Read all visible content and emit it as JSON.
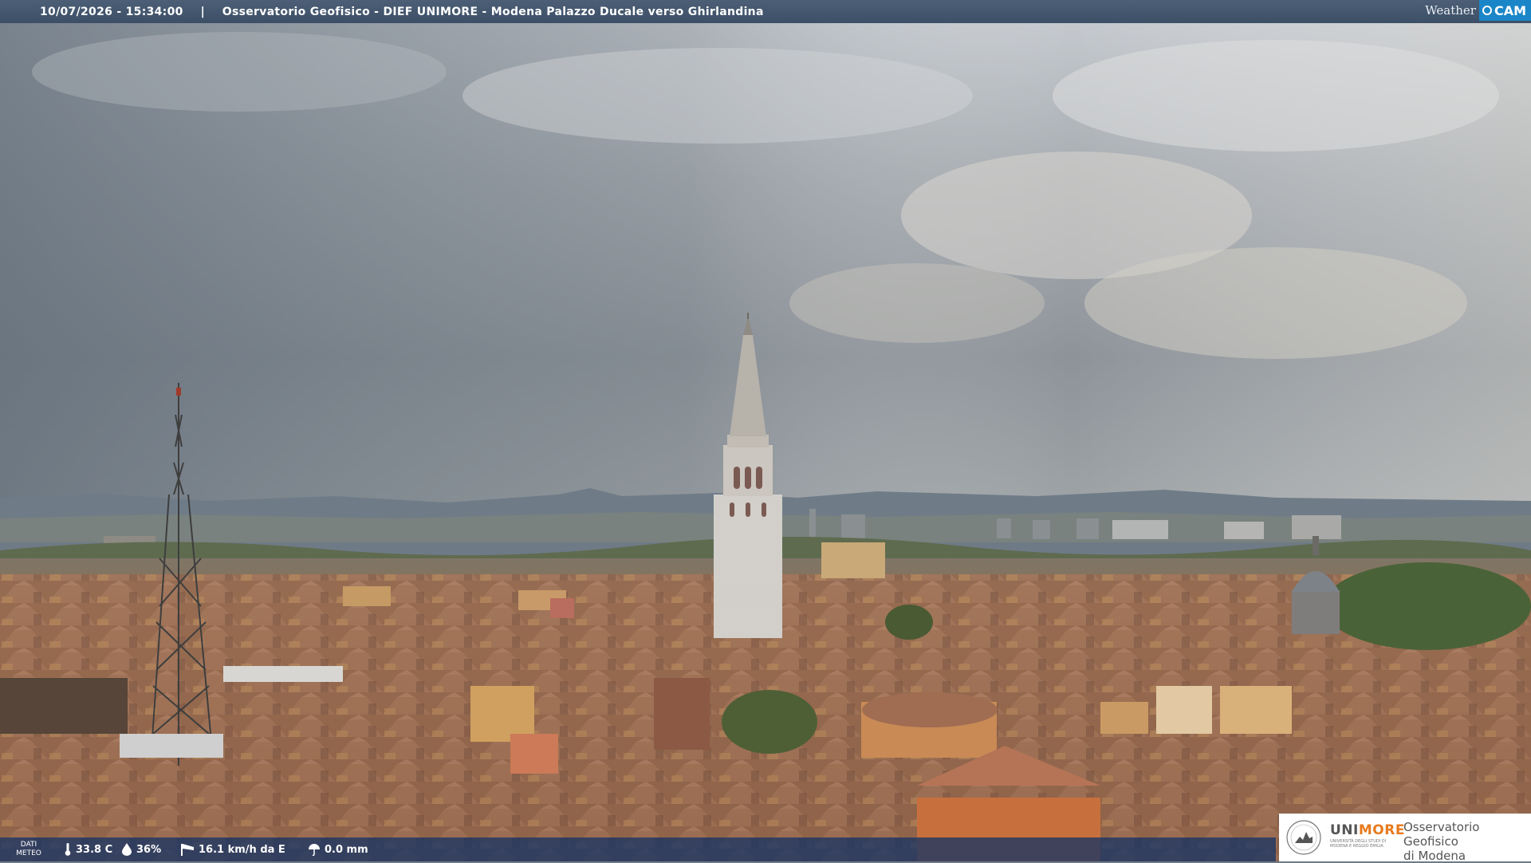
{
  "header": {
    "timestamp": "10/07/2026 - 15:34:00",
    "separator": "|",
    "location": "Osservatorio Geofisico - DIEF UNIMORE - Modena Palazzo Ducale verso Ghirlandina",
    "brand_weather": "Weather",
    "brand_cam": "CAM"
  },
  "weather": {
    "label_line1": "DATI",
    "label_line2": "METEO",
    "temperature": "33.8 C",
    "humidity": "36%",
    "wind": "16.1 km/h da E",
    "rain": "0.0 mm",
    "temperature_icon": "thermometer-icon",
    "humidity_icon": "drop-icon",
    "wind_icon": "windsock-icon",
    "rain_icon": "umbrella-icon"
  },
  "logo": {
    "uni_prefix": "UNI",
    "uni_suffix": "MORE",
    "uni_subtitle": "UNIVERSITÀ DEGLI STUDI DI MODENA E REGGIO EMILIA",
    "observatory_line1": "Osservatorio Geofisico",
    "observatory_line2": "di Modena"
  },
  "colors": {
    "header_bar": "#3c4f66",
    "bottom_bar": "#193464",
    "cam_badge": "#1b86c7",
    "unimore_accent": "#e87a1e",
    "roof_terracotta": "#9a6a4e"
  }
}
